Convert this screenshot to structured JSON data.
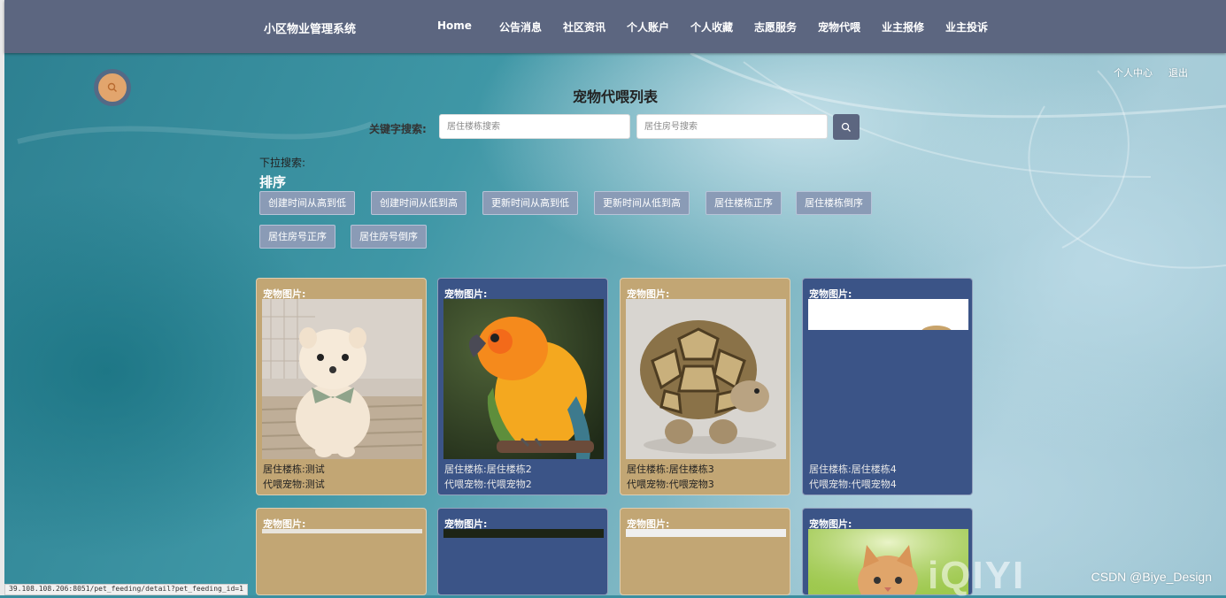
{
  "nav": {
    "brand": "小区物业管理系统",
    "items": [
      "Home",
      "公告消息",
      "社区资讯",
      "个人账户",
      "个人收藏",
      "志愿服务",
      "宠物代喂",
      "业主报修",
      "业主投诉"
    ]
  },
  "top_links": {
    "profile": "个人中心",
    "logout": "退出"
  },
  "page_title": "宠物代喂列表",
  "search": {
    "label": "关键字搜索:",
    "building_placeholder": "居住楼栋搜索",
    "room_placeholder": "居住房号搜索",
    "button_icon": "search-icon"
  },
  "dropdown_label": "下拉搜索:",
  "sort": {
    "heading": "排序",
    "buttons": [
      "创建时间从高到低",
      "创建时间从低到高",
      "更新时间从高到低",
      "更新时间从低到高",
      "居住楼栋正序",
      "居住楼栋倒序",
      "居住房号正序",
      "居住房号倒序"
    ]
  },
  "cards": [
    {
      "label": "宠物图片:",
      "image": "white-pomeranian-dog",
      "line1": "居住楼栋:测试",
      "line2": "代喂宠物:测试",
      "color": "#c2a674"
    },
    {
      "label": "宠物图片:",
      "image": "orange-parrot",
      "line1": "居住楼栋:居住楼栋2",
      "line2": "代喂宠物:代喂宠物2",
      "color": "#3b5487"
    },
    {
      "label": "宠物图片:",
      "image": "tortoise",
      "line1": "居住楼栋:居住楼栋3",
      "line2": "代喂宠物:代喂宠物3",
      "color": "#c2a674"
    },
    {
      "label": "宠物图片:",
      "image": "partially-loaded",
      "line1": "居住楼栋:居住楼栋4",
      "line2": "代喂宠物:代喂宠物4",
      "color": "#3b5487"
    },
    {
      "label": "宠物图片:",
      "image": "loading",
      "color": "#c2a674"
    },
    {
      "label": "宠物图片:",
      "image": "loading-dark",
      "color": "#3b5487"
    },
    {
      "label": "宠物图片:",
      "image": "loading",
      "color": "#c2a674"
    },
    {
      "label": "宠物图片:",
      "image": "kitten",
      "color": "#3b5487"
    }
  ],
  "status_url": "39.108.108.206:8051/pet_feeding/detail?pet_feeding_id=1",
  "watermark": "CSDN @Biye_Design",
  "video_watermark": "iQIYI",
  "colors": {
    "nav": "#5c6680",
    "card_tan": "#c2a674",
    "card_blue": "#3b5487",
    "sort_button": "#8a9bb6",
    "float_button": "#e2a56d"
  }
}
